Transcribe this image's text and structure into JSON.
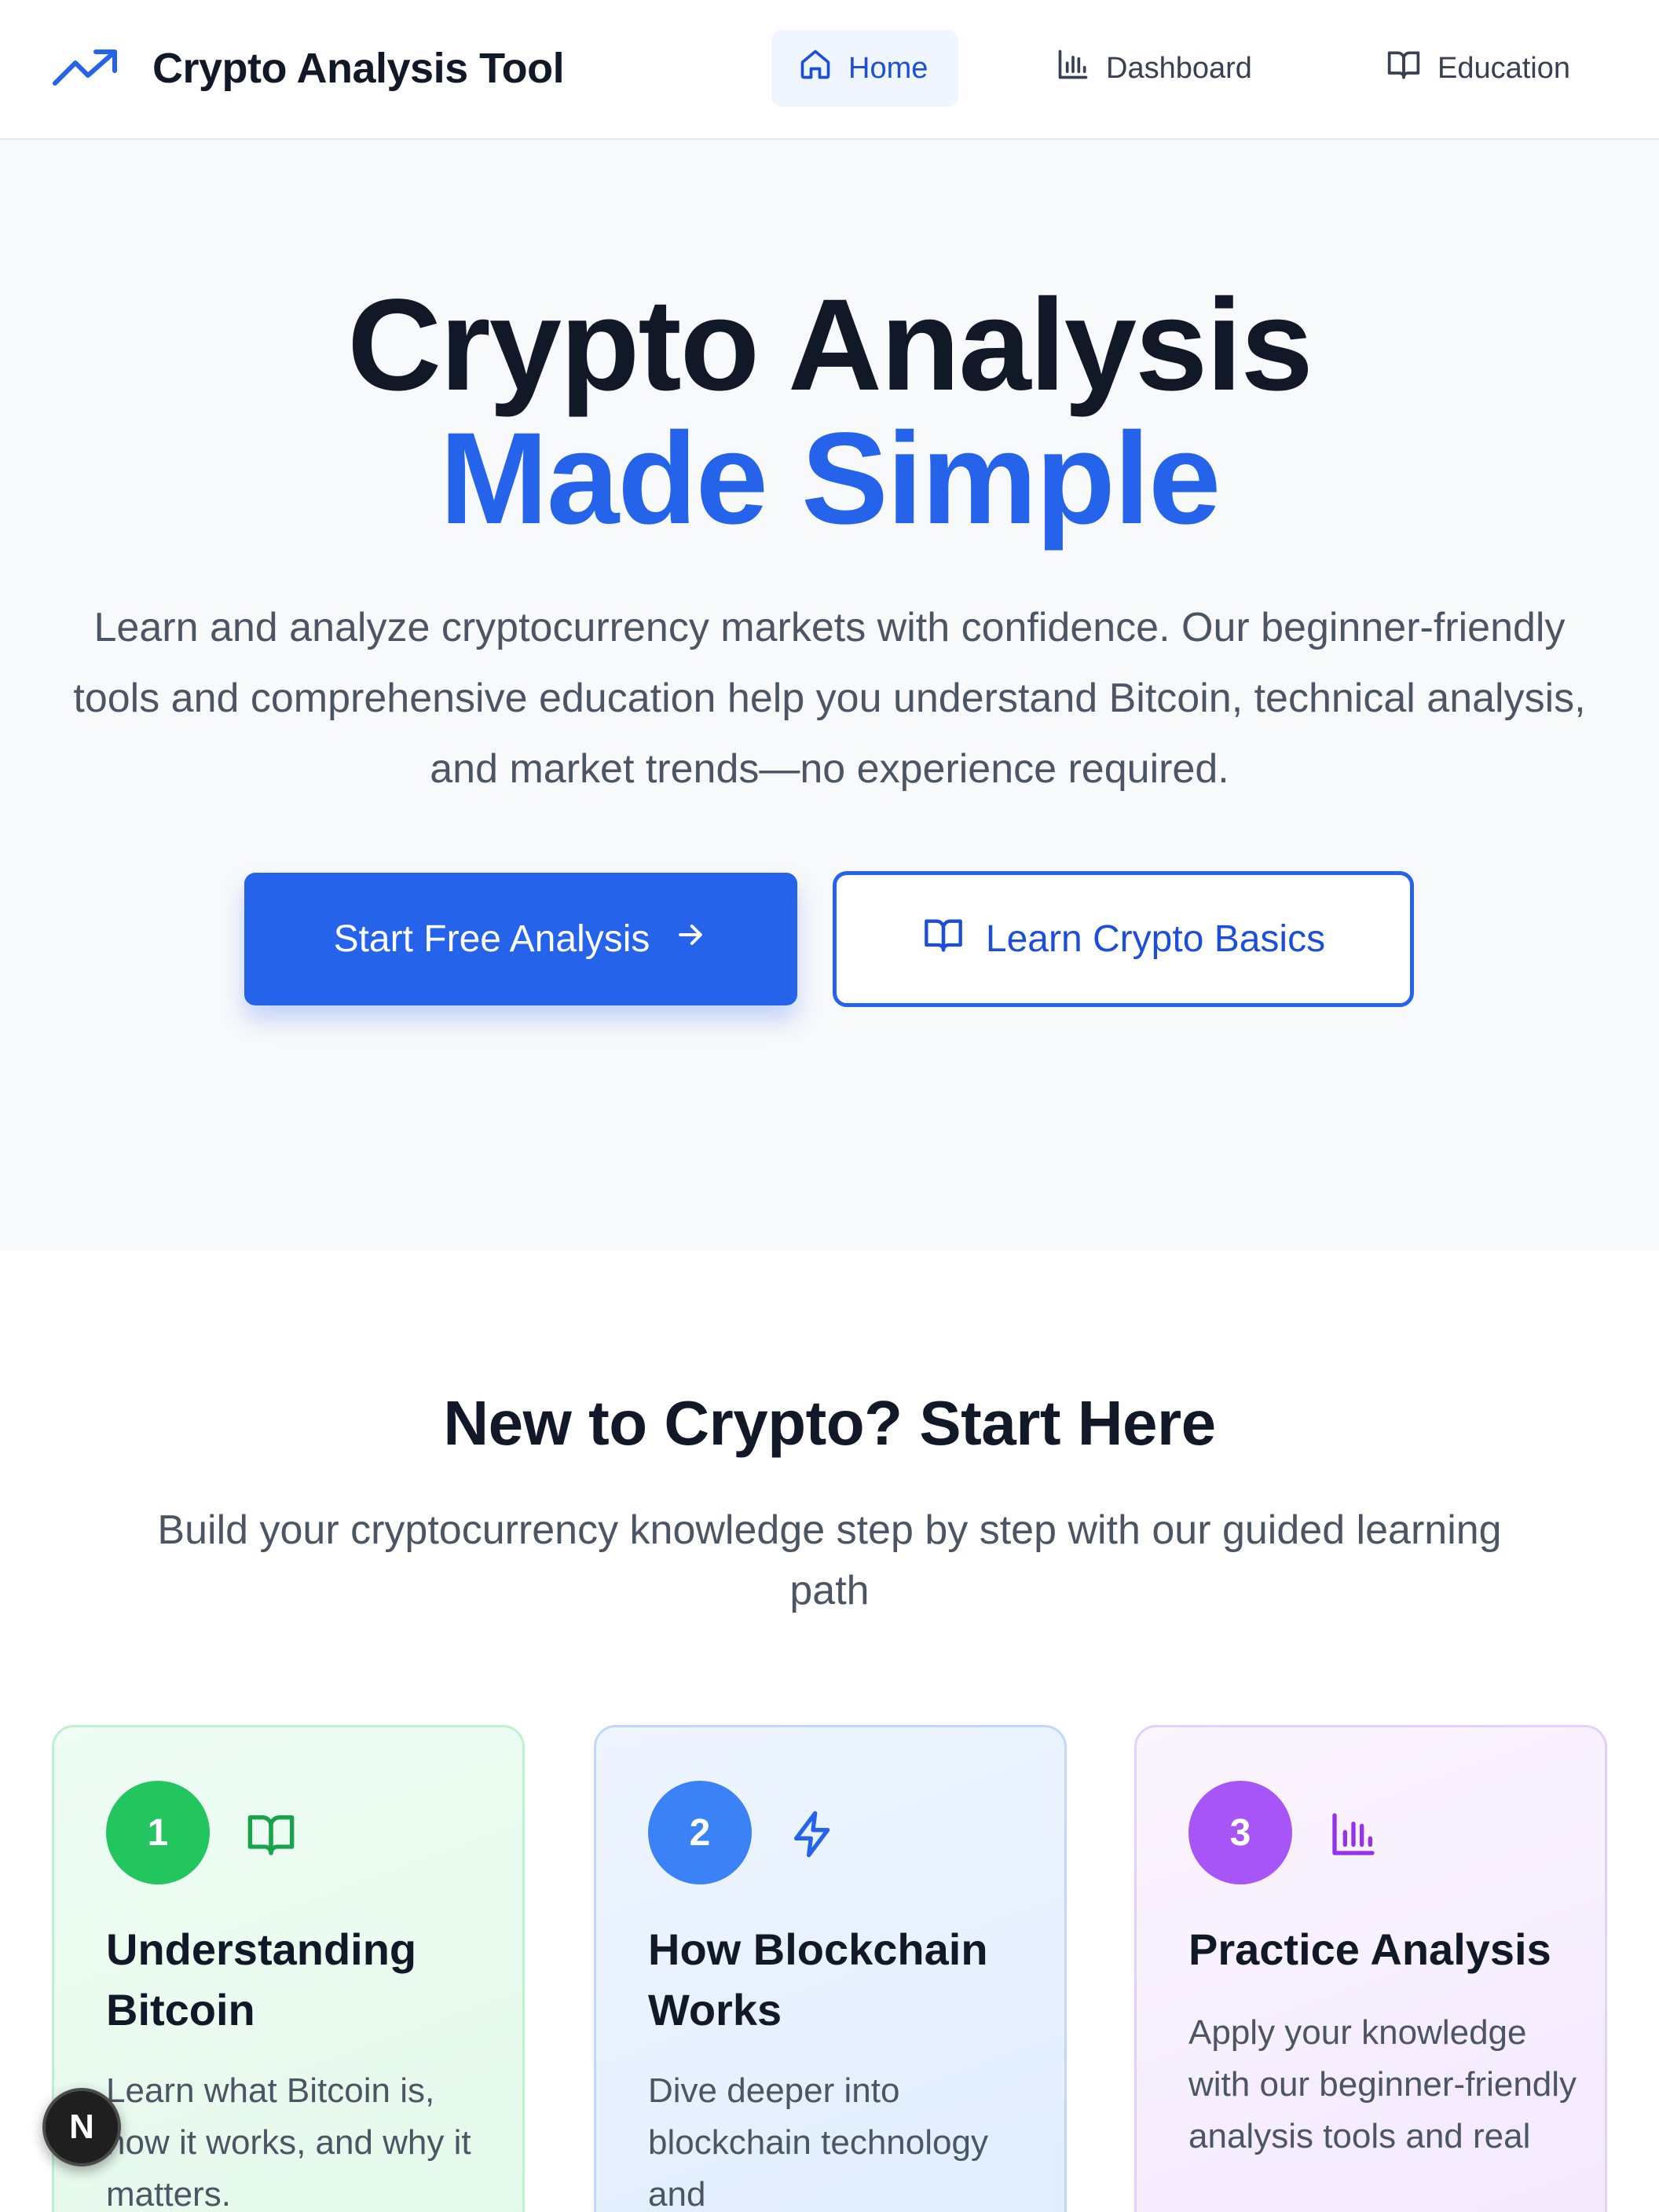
{
  "header": {
    "brand_icon": "trending-up-icon",
    "brand_title": "Crypto Analysis Tool",
    "nav": [
      {
        "label": "Home",
        "icon": "home-icon",
        "active": true
      },
      {
        "label": "Dashboard",
        "icon": "bar-chart-icon",
        "active": false
      },
      {
        "label": "Education",
        "icon": "book-open-icon",
        "active": false
      }
    ]
  },
  "hero": {
    "title_line1": "Crypto Analysis",
    "title_line2": "Made Simple",
    "subtitle": "Learn and analyze cryptocurrency markets with confidence. Our beginner-friendly tools and comprehensive education help you understand Bitcoin, technical analysis, and market trends—no experience required.",
    "primary_button": "Start Free Analysis",
    "primary_icon": "arrow-right-icon",
    "secondary_button": "Learn Crypto Basics",
    "secondary_icon": "book-open-icon"
  },
  "learning": {
    "title": "New to Crypto? Start Here",
    "subtitle": "Build your cryptocurrency knowledge step by step with our guided learning path",
    "cards": [
      {
        "step": "1",
        "icon": "book-open-icon",
        "title": "Understanding Bitcoin",
        "text": "Learn what Bitcoin is, how it works, and why it matters."
      },
      {
        "step": "2",
        "icon": "lightning-icon",
        "title": "How Blockchain Works",
        "text": "Dive deeper into blockchain technology and"
      },
      {
        "step": "3",
        "icon": "bar-chart-icon",
        "title": "Practice Analysis",
        "text": "Apply your knowledge with our beginner-friendly analysis tools and real"
      }
    ]
  },
  "floating_badge": {
    "label": "N"
  },
  "colors": {
    "primary": "#2563eb",
    "heading": "#111827",
    "body_text": "#4b5563",
    "hero_background": "#f8f9fb",
    "step1": "#22c55e",
    "step2": "#3b82f6",
    "step3": "#a855f7"
  }
}
